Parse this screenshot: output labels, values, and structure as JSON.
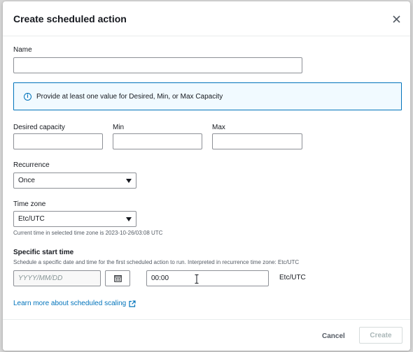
{
  "modal": {
    "title": "Create scheduled action"
  },
  "name": {
    "label": "Name",
    "value": ""
  },
  "alert": {
    "message": "Provide at least one value for Desired, Min, or Max Capacity"
  },
  "capacity": {
    "desired_label": "Desired capacity",
    "min_label": "Min",
    "max_label": "Max",
    "desired_value": "",
    "min_value": "",
    "max_value": ""
  },
  "recurrence": {
    "label": "Recurrence",
    "selected": "Once"
  },
  "timezone": {
    "label": "Time zone",
    "selected": "Etc/UTC",
    "hint": "Current time in selected time zone is 2023-10-26/03:08 UTC"
  },
  "start_time": {
    "label": "Specific start time",
    "description": "Schedule a specific date and time for the first scheduled action to run. Interpreted in recurrence time zone: Etc/UTC",
    "date_placeholder": "YYYY/MM/DD",
    "time_value": "00:00",
    "tz_suffix": "Etc/UTC"
  },
  "learn_more": {
    "text": "Learn more about scheduled scaling"
  },
  "footer": {
    "cancel_label": "Cancel",
    "create_label": "Create"
  },
  "colors": {
    "link": "#0073bb",
    "alert_border": "#0073bb",
    "alert_bg": "#f1faff",
    "disabled_text": "#aab7b8"
  }
}
